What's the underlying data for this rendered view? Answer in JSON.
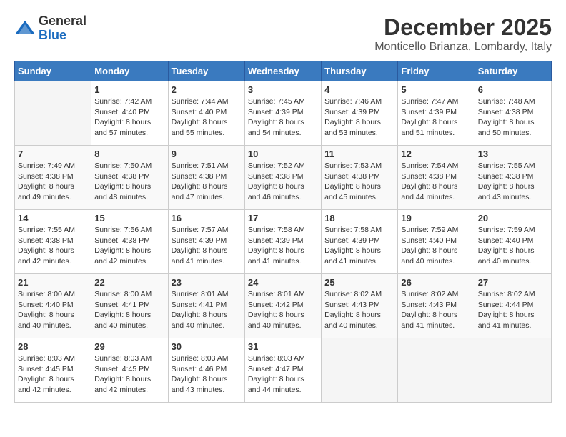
{
  "logo": {
    "general": "General",
    "blue": "Blue"
  },
  "title": "December 2025",
  "subtitle": "Monticello Brianza, Lombardy, Italy",
  "weekdays": [
    "Sunday",
    "Monday",
    "Tuesday",
    "Wednesday",
    "Thursday",
    "Friday",
    "Saturday"
  ],
  "weeks": [
    [
      {
        "day": "",
        "info": ""
      },
      {
        "day": "1",
        "info": "Sunrise: 7:42 AM\nSunset: 4:40 PM\nDaylight: 8 hours\nand 57 minutes."
      },
      {
        "day": "2",
        "info": "Sunrise: 7:44 AM\nSunset: 4:40 PM\nDaylight: 8 hours\nand 55 minutes."
      },
      {
        "day": "3",
        "info": "Sunrise: 7:45 AM\nSunset: 4:39 PM\nDaylight: 8 hours\nand 54 minutes."
      },
      {
        "day": "4",
        "info": "Sunrise: 7:46 AM\nSunset: 4:39 PM\nDaylight: 8 hours\nand 53 minutes."
      },
      {
        "day": "5",
        "info": "Sunrise: 7:47 AM\nSunset: 4:39 PM\nDaylight: 8 hours\nand 51 minutes."
      },
      {
        "day": "6",
        "info": "Sunrise: 7:48 AM\nSunset: 4:38 PM\nDaylight: 8 hours\nand 50 minutes."
      }
    ],
    [
      {
        "day": "7",
        "info": "Sunrise: 7:49 AM\nSunset: 4:38 PM\nDaylight: 8 hours\nand 49 minutes."
      },
      {
        "day": "8",
        "info": "Sunrise: 7:50 AM\nSunset: 4:38 PM\nDaylight: 8 hours\nand 48 minutes."
      },
      {
        "day": "9",
        "info": "Sunrise: 7:51 AM\nSunset: 4:38 PM\nDaylight: 8 hours\nand 47 minutes."
      },
      {
        "day": "10",
        "info": "Sunrise: 7:52 AM\nSunset: 4:38 PM\nDaylight: 8 hours\nand 46 minutes."
      },
      {
        "day": "11",
        "info": "Sunrise: 7:53 AM\nSunset: 4:38 PM\nDaylight: 8 hours\nand 45 minutes."
      },
      {
        "day": "12",
        "info": "Sunrise: 7:54 AM\nSunset: 4:38 PM\nDaylight: 8 hours\nand 44 minutes."
      },
      {
        "day": "13",
        "info": "Sunrise: 7:55 AM\nSunset: 4:38 PM\nDaylight: 8 hours\nand 43 minutes."
      }
    ],
    [
      {
        "day": "14",
        "info": "Sunrise: 7:55 AM\nSunset: 4:38 PM\nDaylight: 8 hours\nand 42 minutes."
      },
      {
        "day": "15",
        "info": "Sunrise: 7:56 AM\nSunset: 4:38 PM\nDaylight: 8 hours\nand 42 minutes."
      },
      {
        "day": "16",
        "info": "Sunrise: 7:57 AM\nSunset: 4:39 PM\nDaylight: 8 hours\nand 41 minutes."
      },
      {
        "day": "17",
        "info": "Sunrise: 7:58 AM\nSunset: 4:39 PM\nDaylight: 8 hours\nand 41 minutes."
      },
      {
        "day": "18",
        "info": "Sunrise: 7:58 AM\nSunset: 4:39 PM\nDaylight: 8 hours\nand 41 minutes."
      },
      {
        "day": "19",
        "info": "Sunrise: 7:59 AM\nSunset: 4:40 PM\nDaylight: 8 hours\nand 40 minutes."
      },
      {
        "day": "20",
        "info": "Sunrise: 7:59 AM\nSunset: 4:40 PM\nDaylight: 8 hours\nand 40 minutes."
      }
    ],
    [
      {
        "day": "21",
        "info": "Sunrise: 8:00 AM\nSunset: 4:40 PM\nDaylight: 8 hours\nand 40 minutes."
      },
      {
        "day": "22",
        "info": "Sunrise: 8:00 AM\nSunset: 4:41 PM\nDaylight: 8 hours\nand 40 minutes."
      },
      {
        "day": "23",
        "info": "Sunrise: 8:01 AM\nSunset: 4:41 PM\nDaylight: 8 hours\nand 40 minutes."
      },
      {
        "day": "24",
        "info": "Sunrise: 8:01 AM\nSunset: 4:42 PM\nDaylight: 8 hours\nand 40 minutes."
      },
      {
        "day": "25",
        "info": "Sunrise: 8:02 AM\nSunset: 4:43 PM\nDaylight: 8 hours\nand 40 minutes."
      },
      {
        "day": "26",
        "info": "Sunrise: 8:02 AM\nSunset: 4:43 PM\nDaylight: 8 hours\nand 41 minutes."
      },
      {
        "day": "27",
        "info": "Sunrise: 8:02 AM\nSunset: 4:44 PM\nDaylight: 8 hours\nand 41 minutes."
      }
    ],
    [
      {
        "day": "28",
        "info": "Sunrise: 8:03 AM\nSunset: 4:45 PM\nDaylight: 8 hours\nand 42 minutes."
      },
      {
        "day": "29",
        "info": "Sunrise: 8:03 AM\nSunset: 4:45 PM\nDaylight: 8 hours\nand 42 minutes."
      },
      {
        "day": "30",
        "info": "Sunrise: 8:03 AM\nSunset: 4:46 PM\nDaylight: 8 hours\nand 43 minutes."
      },
      {
        "day": "31",
        "info": "Sunrise: 8:03 AM\nSunset: 4:47 PM\nDaylight: 8 hours\nand 44 minutes."
      },
      {
        "day": "",
        "info": ""
      },
      {
        "day": "",
        "info": ""
      },
      {
        "day": "",
        "info": ""
      }
    ]
  ]
}
